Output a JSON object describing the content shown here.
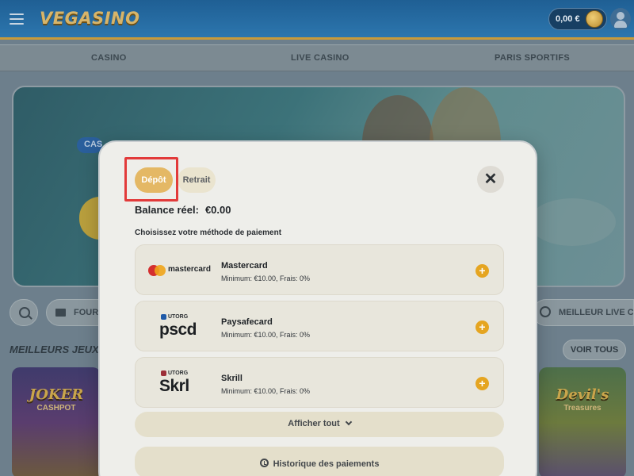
{
  "header": {
    "logo": "VEGASINO",
    "balance": "0,00 €"
  },
  "nav": {
    "items": [
      "CASINO",
      "LIVE CASINO",
      "PARIS SPORTIFS"
    ]
  },
  "hero": {
    "tag": "CAS"
  },
  "filters": {
    "folder_label": "FOUR",
    "live_label": "MEILLEUR LIVE CAS"
  },
  "games_section": {
    "title": "MEILLEURS JEUX",
    "see_all": "VOIR TOUS",
    "left_game_title": "JOKER",
    "left_game_sub": "CASHPOT",
    "right_game_title": "Devil's",
    "right_game_sub": "Treasures"
  },
  "modal": {
    "tabs": {
      "deposit": "Dépôt",
      "withdraw": "Retrait"
    },
    "close_glyph": "✕",
    "balance_label": "Balance réel:",
    "balance_value": "€0.00",
    "choose_label": "Choisissez votre méthode de paiement",
    "methods": [
      {
        "logo_text": "mastercard",
        "name": "Mastercard",
        "info": "Minimum: €10.00, Frais: 0%"
      },
      {
        "logo_small": "UTORG",
        "logo_text": "pscd",
        "name": "Paysafecard",
        "info": "Minimum: €10.00, Frais: 0%"
      },
      {
        "logo_small": "UTORG",
        "logo_text": "Skrl",
        "name": "Skrill",
        "info": "Minimum: €10.00, Frais: 0%"
      }
    ],
    "plus_glyph": "+",
    "show_all": "Afficher tout",
    "history": "Historique des paiements"
  },
  "colors": {
    "accent": "#e5a521",
    "deposit_tab": "#e4b865",
    "highlight": "#e23a3a"
  }
}
